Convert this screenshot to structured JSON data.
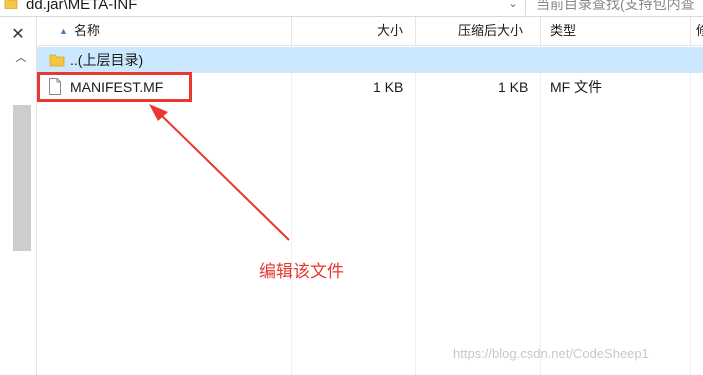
{
  "address_bar": {
    "path": "dd.jar\\META-INF"
  },
  "search_box": {
    "placeholder": "当前目录查找(支持包内查"
  },
  "columns": {
    "name": "名称",
    "size": "大小",
    "compressed_size": "压缩后大小",
    "type": "类型",
    "extra": "修"
  },
  "rows": [
    {
      "name": "..(上层目录)",
      "size": "",
      "compressed_size": "",
      "type": ""
    },
    {
      "name": "MANIFEST.MF",
      "size": "1 KB",
      "compressed_size": "1 KB",
      "type": "MF 文件"
    }
  ],
  "annotation": {
    "text": "编辑该文件",
    "color": "#e8382f"
  },
  "watermark": "https://blog.csdn.net/CodeSheep1",
  "colors": {
    "selection": "#cce8ff",
    "accent": "#2b6cc4"
  }
}
